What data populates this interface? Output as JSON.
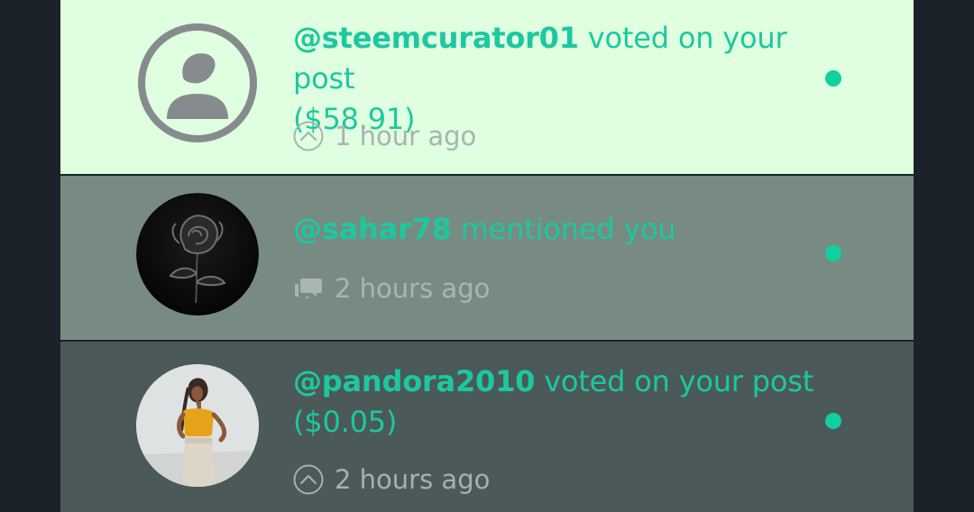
{
  "notifications": [
    {
      "username": "@steemcurator01",
      "action": " voted on your post",
      "detail": "($58.91)",
      "time": "1 hour ago",
      "type_icon": "upvote-icon",
      "avatar": "default-user-avatar",
      "unread": true
    },
    {
      "username": "@sahar78",
      "action": " mentioned you",
      "detail": "",
      "time": "2 hours ago",
      "type_icon": "comment-icon",
      "avatar": "black-rose-avatar",
      "unread": true
    },
    {
      "username": "@pandora2010",
      "action": " voted on your post",
      "detail": "($0.05)",
      "time": "2 hours ago",
      "type_icon": "upvote-icon",
      "avatar": "user-photo-avatar",
      "unread": true
    }
  ],
  "colors": {
    "accent": "#1cc8a0",
    "unread_dot": "#10cfa0",
    "background": "#1c2229"
  }
}
